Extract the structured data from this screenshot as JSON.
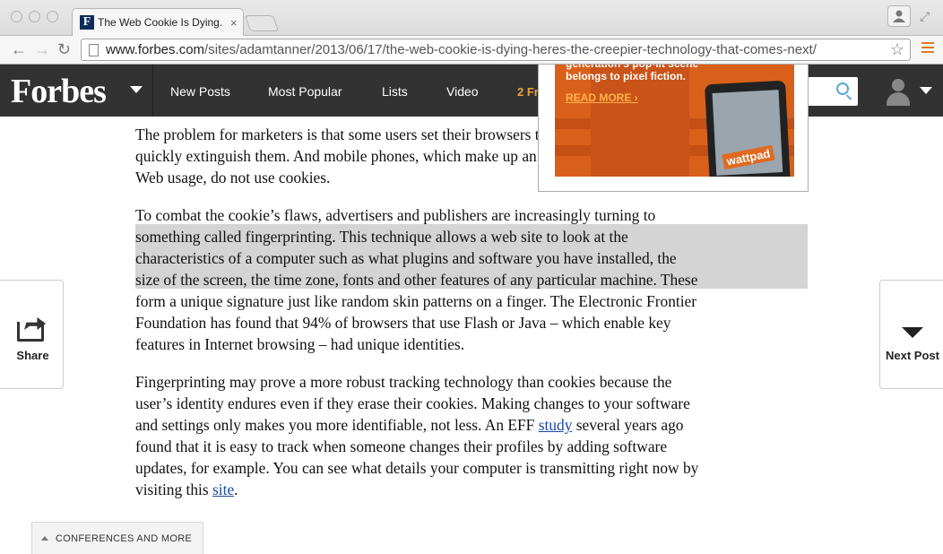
{
  "browser": {
    "tab_title": "The Web Cookie Is Dying. Here's The Creepier Technology That Comes Next",
    "tab_close": "×",
    "favicon_letter": "F",
    "url_host": "www.forbes.com",
    "url_path": "/sites/adamtanner/2013/06/17/the-web-cookie-is-dying-heres-the-creepier-technology-that-comes-next/",
    "back": "←",
    "forward": "→",
    "reload": "↻",
    "star": "☆",
    "expand": "⤢"
  },
  "header": {
    "logo": "Forbes",
    "nav": [
      "New Posts",
      "Most Popular",
      "Lists",
      "Video",
      "2 Fr"
    ],
    "accent": "#e8a23a"
  },
  "ad": {
    "text": "generation's pop-lit scene belongs to pixel fiction.",
    "read_more": "READ MORE ›",
    "brand": "wattpad"
  },
  "article": {
    "p1": "The problem for marketers is that some users set their browsers to block cookies or quickly extinguish them. And mobile phones, which make up an increasing chunk of the Web usage, do not use cookies.",
    "p2_a": "To combat the cookie’s flaws, advertisers and publishers are increasingly turning to something called fingerprinting. ",
    "p2_hl": "This technique allows a web site to look at the characteristics of a computer such as what plugins and software you have installed, the size of the screen, the time zone, fonts and other features of any particular machine.",
    "p2_b": " These form a unique signature just like random skin patterns on a finger. The Electronic Frontier Foundation has found that 94% of browsers that use Flash or Java – which enable key features in Internet browsing – had unique identities.",
    "p3_a": "Fingerprinting may prove a more robust tracking technology than cookies because the user’s identity endures even if they erase their cookies. Making changes to your software and settings only makes you more identifiable, not less. An EFF ",
    "p3_link1": "study",
    "p3_b": " several years ago found that it is easy to track when someone changes their profiles by adding software updates, for example. You can see what details your computer is transmitting right now by visiting this ",
    "p3_link2": "site",
    "p3_c": "."
  },
  "side": {
    "share": "Share",
    "next_post": "Next Post"
  },
  "footer_tab": {
    "label": "CONFERENCES AND MORE"
  }
}
